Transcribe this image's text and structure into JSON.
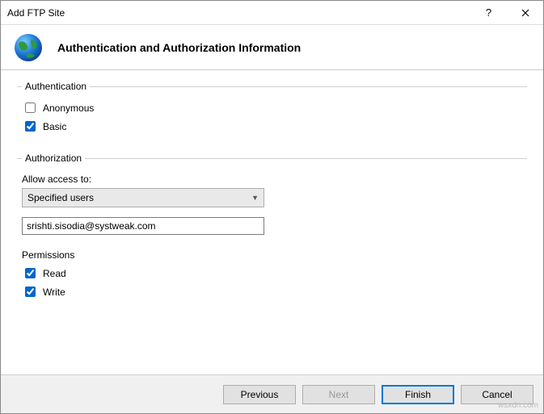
{
  "window": {
    "title": "Add FTP Site"
  },
  "header": {
    "title": "Authentication and Authorization Information"
  },
  "authentication": {
    "label": "Authentication",
    "anonymous_label": "Anonymous",
    "anonymous_checked": false,
    "basic_label": "Basic",
    "basic_checked": true
  },
  "authorization": {
    "label": "Authorization",
    "allow_label": "Allow access to:",
    "selected": "Specified users",
    "user_value": "srishti.sisodia@systweak.com",
    "permissions_label": "Permissions",
    "read_label": "Read",
    "read_checked": true,
    "write_label": "Write",
    "write_checked": true
  },
  "buttons": {
    "previous": "Previous",
    "next": "Next",
    "finish": "Finish",
    "cancel": "Cancel"
  },
  "watermark": "wsxdn.com"
}
